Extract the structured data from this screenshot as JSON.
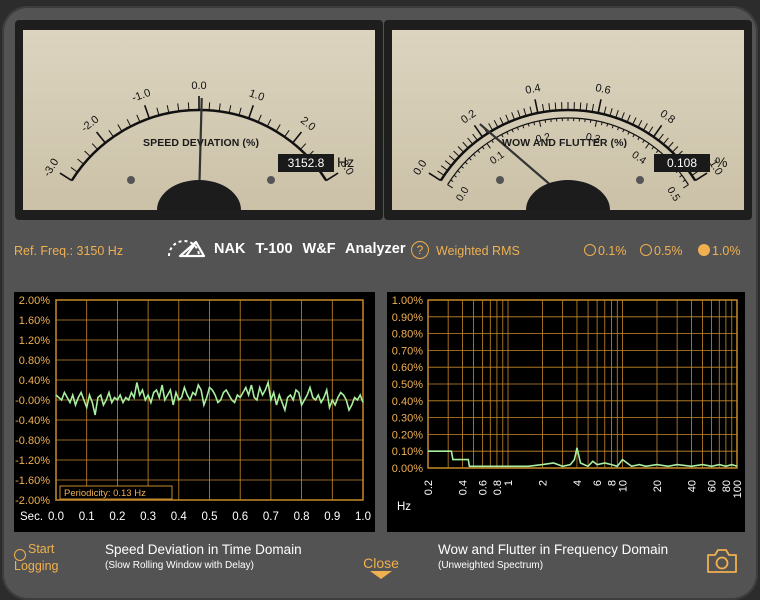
{
  "speed_meter": {
    "title": "SPEED DEVIATION (%)",
    "scale_labels": [
      "-3.0",
      "-2.0",
      "-1.0",
      "0.0",
      "1.0",
      "2.0",
      "3.0"
    ],
    "readout_value": "3152.8",
    "readout_unit": "Hz",
    "needle_value": 0.05
  },
  "flutter_meter": {
    "title": "WOW AND FLUTTER (%)",
    "outer_labels": [
      "0.0",
      "0.2",
      "0.4",
      "0.6",
      "0.8",
      "1.0"
    ],
    "inner_labels": [
      "0.0",
      "0.1",
      "0.2",
      "0.3",
      "0.4",
      "0.5"
    ],
    "readout_value": "0.108",
    "readout_unit": "%",
    "needle_value": 0.108
  },
  "toolbar": {
    "ref_freq": "Ref. Freq.: 3150 Hz",
    "brand": "NAK  T-100  W&F  Analyzer",
    "help_label": "?",
    "weighted": "Weighted RMS",
    "range_options": [
      "0.1%",
      "0.5%",
      "1.0%"
    ],
    "selected_range": "1.0%"
  },
  "time_graph": {
    "title": "Speed Deviation in Time Domain",
    "subtitle": "(Slow Rolling Window with Delay)",
    "periodicity": "Periodicity:  0.13 Hz",
    "x_axis_label": "Sec."
  },
  "freq_graph": {
    "title": "Wow and Flutter in Frequency Domain",
    "subtitle": "(Unweighted Spectrum)",
    "x_axis_label": "Hz"
  },
  "controls": {
    "start_label_1": "Start",
    "start_label_2": "Logging",
    "close_label": "Close",
    "camera_icon": "camera-icon"
  },
  "colors": {
    "accent": "#f0b050",
    "trace": "#a8f0a0",
    "grid": "#c88a2a",
    "meter_face": "#d3cab3"
  },
  "chart_data": [
    {
      "type": "line",
      "title": "Speed Deviation in Time Domain",
      "xlabel": "Sec.",
      "ylabel": "",
      "xlim": [
        0.0,
        1.0
      ],
      "ylim": [
        -2.0,
        2.0
      ],
      "x_ticks": [
        "0.0",
        "0.1",
        "0.2",
        "0.3",
        "0.4",
        "0.5",
        "0.6",
        "0.7",
        "0.8",
        "0.9",
        "1.0"
      ],
      "y_ticks": [
        "2.00%",
        "1.60%",
        "1.20%",
        "0.80%",
        "0.40%",
        "-0.00%",
        "-0.40%",
        "-0.80%",
        "-1.20%",
        "-1.60%",
        "-2.00%"
      ],
      "grid": true,
      "series": [
        {
          "values": [
            0.1,
            0.05,
            0.0,
            0.15,
            0.05,
            -0.05,
            0.1,
            -0.1,
            0.05,
            0.15,
            0.0,
            -0.15,
            0.1,
            -0.05,
            -0.3,
            0.05,
            0.1,
            -0.1,
            0.0,
            0.15,
            -0.05,
            0.05,
            0.0,
            0.1,
            -0.05,
            0.05,
            0.0,
            0.15,
            0.05,
            0.35,
            0.1,
            0.2,
            0.0,
            0.1,
            -0.05,
            0.15,
            0.2,
            0.05,
            0.3,
            0.0,
            0.1,
            0.2,
            -0.1,
            0.15,
            0.0,
            0.05,
            0.25,
            0.1,
            0.0,
            0.15,
            0.1,
            0.3,
            0.2,
            -0.1,
            0.05,
            0.25,
            0.2,
            0.1,
            -0.05,
            0.0,
            0.15,
            0.2,
            0.1,
            0.0,
            -0.05,
            0.1,
            0.05,
            0.15,
            0.25,
            0.1,
            0.3,
            0.05,
            0.0,
            0.25,
            0.1,
            0.2,
            0.35,
            0.0,
            0.15,
            -0.1,
            0.1,
            -0.05,
            -0.2,
            0.05,
            0.1,
            0.0,
            0.2,
            0.15,
            -0.1,
            0.0,
            0.1,
            0.25,
            0.05,
            0.0,
            0.1,
            -0.05,
            0.05,
            0.2,
            -0.15,
            0.0,
            -0.1,
            0.05,
            0.15,
            0.1,
            0.0,
            -0.2,
            -0.1,
            0.05,
            0.0,
            0.1,
            -0.05
          ]
        }
      ]
    },
    {
      "type": "line",
      "title": "Wow and Flutter in Frequency Domain",
      "xlabel": "Hz",
      "ylabel": "",
      "x_scale": "log",
      "xlim": [
        0.2,
        100
      ],
      "ylim": [
        0.0,
        1.0
      ],
      "x_ticks": [
        "0.2",
        "0.4",
        "0.6",
        "0.8",
        "1",
        "2",
        "4",
        "6",
        "8",
        "10",
        "20",
        "40",
        "60",
        "80",
        "100"
      ],
      "y_ticks": [
        "1.00%",
        "0.90%",
        "0.80%",
        "0.70%",
        "0.60%",
        "0.50%",
        "0.40%",
        "0.30%",
        "0.20%",
        "0.10%",
        "0.00%"
      ],
      "grid": true,
      "series": [
        {
          "x": [
            0.2,
            0.32,
            0.33,
            0.45,
            0.46,
            0.6,
            0.8,
            1.0,
            1.5,
            2.0,
            2.5,
            3.0,
            3.5,
            3.8,
            4.0,
            4.3,
            5.0,
            5.5,
            6.0,
            7.0,
            8.0,
            9.0,
            10,
            12,
            14,
            16,
            20,
            25,
            30,
            40,
            50,
            60,
            70,
            80,
            90,
            100
          ],
          "values": [
            0.1,
            0.1,
            0.05,
            0.05,
            0.01,
            0.01,
            0.01,
            0.01,
            0.01,
            0.02,
            0.03,
            0.01,
            0.02,
            0.05,
            0.12,
            0.03,
            0.01,
            0.04,
            0.02,
            0.03,
            0.02,
            0.01,
            0.05,
            0.01,
            0.02,
            0.01,
            0.02,
            0.01,
            0.02,
            0.01,
            0.02,
            0.01,
            0.02,
            0.01,
            0.02,
            0.01
          ]
        }
      ]
    }
  ]
}
